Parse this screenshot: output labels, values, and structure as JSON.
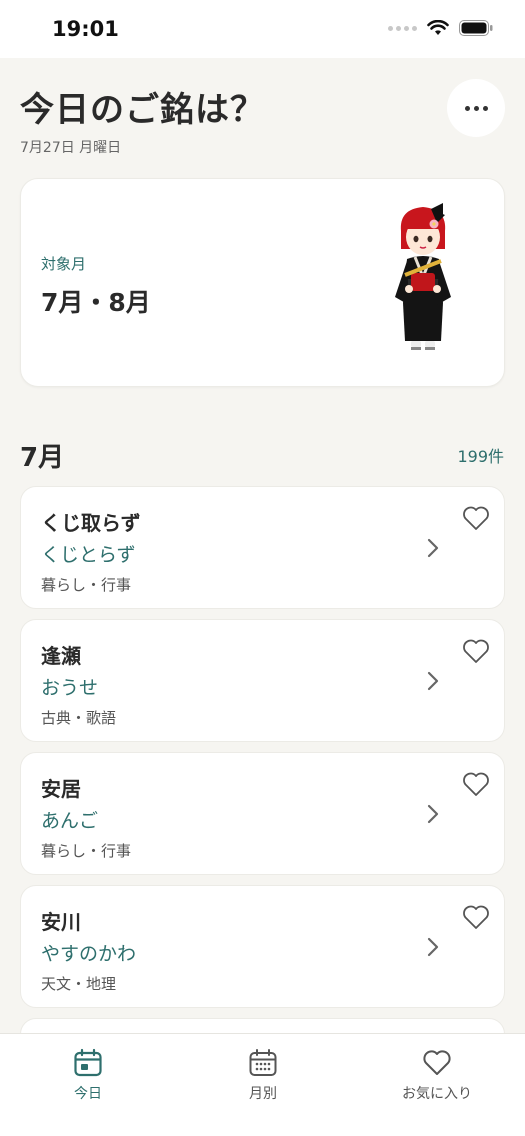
{
  "status_bar": {
    "time": "19:01"
  },
  "header": {
    "title": "今日のご銘は？",
    "date": "7月27日 月曜日"
  },
  "target": {
    "label": "対象月",
    "months": "7月・8月"
  },
  "section": {
    "title": "7月",
    "count": "199件"
  },
  "items": [
    {
      "name": "くじ取らず",
      "reading": "くじとらず",
      "category": "暮らし・行事"
    },
    {
      "name": "逢瀬",
      "reading": "おうせ",
      "category": "古典・歌語"
    },
    {
      "name": "安居",
      "reading": "あんご",
      "category": "暮らし・行事"
    },
    {
      "name": "安川",
      "reading": "やすのかわ",
      "category": "天文・地理"
    }
  ],
  "tabs": [
    {
      "label": "今日",
      "icon": "calendar-today-icon",
      "active": true
    },
    {
      "label": "月別",
      "icon": "calendar-grid-icon",
      "active": false
    },
    {
      "label": "お気に入り",
      "icon": "heart-icon",
      "active": false
    }
  ],
  "colors": {
    "accent": "#2e6f6d",
    "background": "#f6f5f1",
    "card": "#ffffff"
  }
}
